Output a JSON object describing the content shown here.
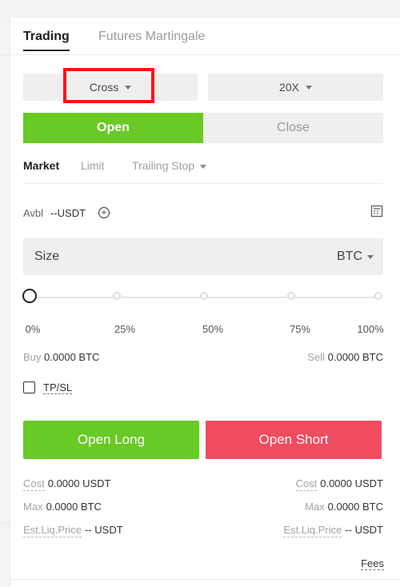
{
  "tabs": [
    {
      "label": "Trading"
    },
    {
      "label": "Futures Martingale"
    }
  ],
  "selectors": {
    "margin_mode": "Cross",
    "leverage": "20X"
  },
  "action_toggle": {
    "open": "Open",
    "close": "Close"
  },
  "order_types": {
    "market": "Market",
    "limit": "Limit",
    "trailing_stop": "Trailing Stop"
  },
  "available": {
    "label": "Avbl",
    "value": "--USDT",
    "plus_icon": "+"
  },
  "size": {
    "label": "Size",
    "unit": "BTC"
  },
  "slider": {
    "labels": [
      "0%",
      "25%",
      "50%",
      "75%",
      "100%"
    ],
    "value": 0
  },
  "summary": {
    "buy_label": "Buy",
    "buy_value": "0.0000 BTC",
    "sell_label": "Sell",
    "sell_value": "0.0000 BTC"
  },
  "tpsl": {
    "label": "TP/SL",
    "checked": false
  },
  "buttons": {
    "open_long": "Open Long",
    "open_short": "Open Short"
  },
  "stats": {
    "cost_left_label": "Cost",
    "cost_left_value": "0.0000 USDT",
    "cost_right_label": "Cost",
    "cost_right_value": "0.0000 USDT",
    "max_left_label": "Max",
    "max_left_value": "0.0000 BTC",
    "max_right_label": "Max",
    "max_right_value": "0.0000 BTC",
    "liq_left_label": "Est.Liq.Price",
    "liq_left_value": "-- USDT",
    "liq_right_label": "Est.Liq.Price",
    "liq_right_value": "-- USDT"
  },
  "fees": {
    "label": "Fees"
  },
  "colors": {
    "green": "#69c925",
    "red": "#f04b5f",
    "highlight": "#ff0f12"
  }
}
